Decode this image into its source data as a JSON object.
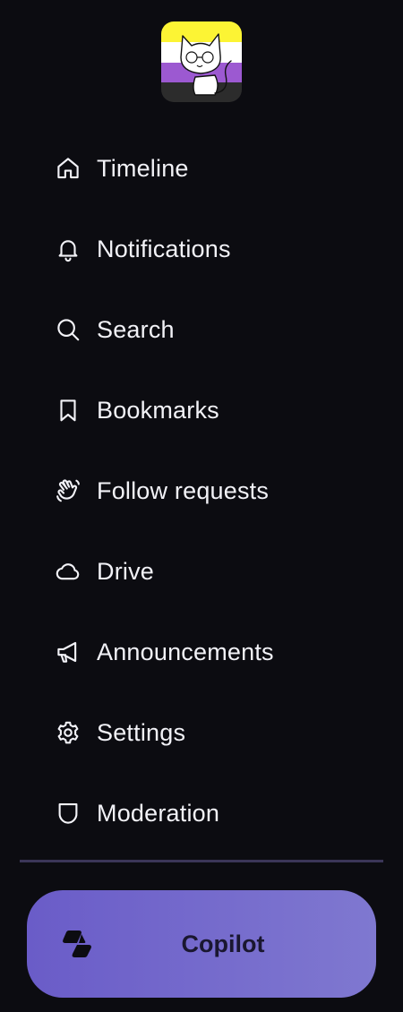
{
  "avatar": {
    "name": "user-avatar",
    "flag_colors": [
      "#fcf434",
      "#ffffff",
      "#9c59d1",
      "#2c2c2c"
    ]
  },
  "nav": {
    "items": [
      {
        "label": "Timeline",
        "icon": "home-icon"
      },
      {
        "label": "Notifications",
        "icon": "bell-icon"
      },
      {
        "label": "Search",
        "icon": "search-icon"
      },
      {
        "label": "Bookmarks",
        "icon": "bookmark-icon"
      },
      {
        "label": "Follow requests",
        "icon": "hand-wave-icon"
      },
      {
        "label": "Drive",
        "icon": "cloud-icon"
      },
      {
        "label": "Announcements",
        "icon": "megaphone-icon"
      },
      {
        "label": "Settings",
        "icon": "gear-icon"
      },
      {
        "label": "Moderation",
        "icon": "shield-icon"
      }
    ]
  },
  "copilot": {
    "label": "Copilot",
    "icon": "copilot-icon",
    "gradient_start": "#6a5cc8",
    "gradient_end": "#7f78d0"
  },
  "colors": {
    "background": "#0c0c11",
    "text": "#f2f2f7",
    "divider": "#3b3658"
  }
}
